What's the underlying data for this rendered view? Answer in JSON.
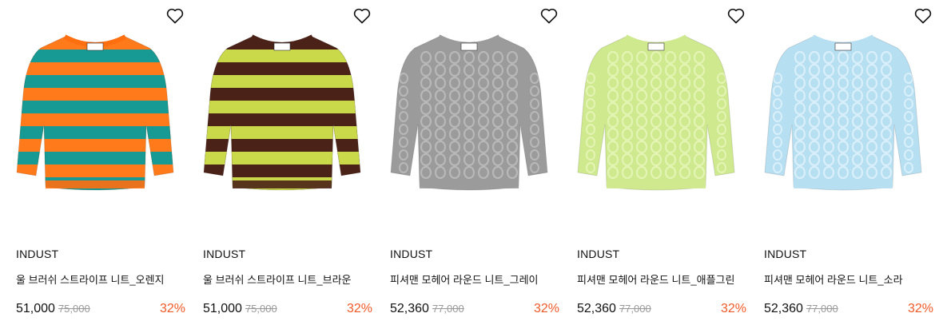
{
  "products": [
    {
      "brand": "INDUST",
      "name": "울 브러쉬 스트라이프 니트_오렌지",
      "price": "51,000",
      "original_price": "75,000",
      "discount": "32%",
      "colors": {
        "a": "#ff7a1a",
        "b": "#169a93",
        "trim": "#ff6f10"
      },
      "pattern": "stripe"
    },
    {
      "brand": "INDUST",
      "name": "울 브러쉬 스트라이프 니트_브라운",
      "price": "51,000",
      "original_price": "75,000",
      "discount": "32%",
      "colors": {
        "a": "#4a2218",
        "b": "#c9d94a",
        "trim": "#4a2218"
      },
      "pattern": "stripe"
    },
    {
      "brand": "INDUST",
      "name": "피셔맨 모헤어 라운드 니트_그레이",
      "price": "52,360",
      "original_price": "77,000",
      "discount": "32%",
      "colors": {
        "a": "#9b9b9b",
        "b": "#b8b8b8",
        "trim": "#9b9b9b"
      },
      "pattern": "cable"
    },
    {
      "brand": "INDUST",
      "name": "피셔맨 모헤어 라운드 니트_애플그린",
      "price": "52,360",
      "original_price": "77,000",
      "discount": "32%",
      "colors": {
        "a": "#cfe98e",
        "b": "#e4f4b4",
        "trim": "#cfe98e"
      },
      "pattern": "cable"
    },
    {
      "brand": "INDUST",
      "name": "피셔맨 모헤어 라운드 니트_소라",
      "price": "52,360",
      "original_price": "77,000",
      "discount": "32%",
      "colors": {
        "a": "#b7dff2",
        "b": "#d9eff9",
        "trim": "#b7dff2"
      },
      "pattern": "cable"
    }
  ],
  "icons": {
    "wishlist": "heart-outline-icon"
  },
  "accent": {
    "discount": "#f05a28"
  }
}
